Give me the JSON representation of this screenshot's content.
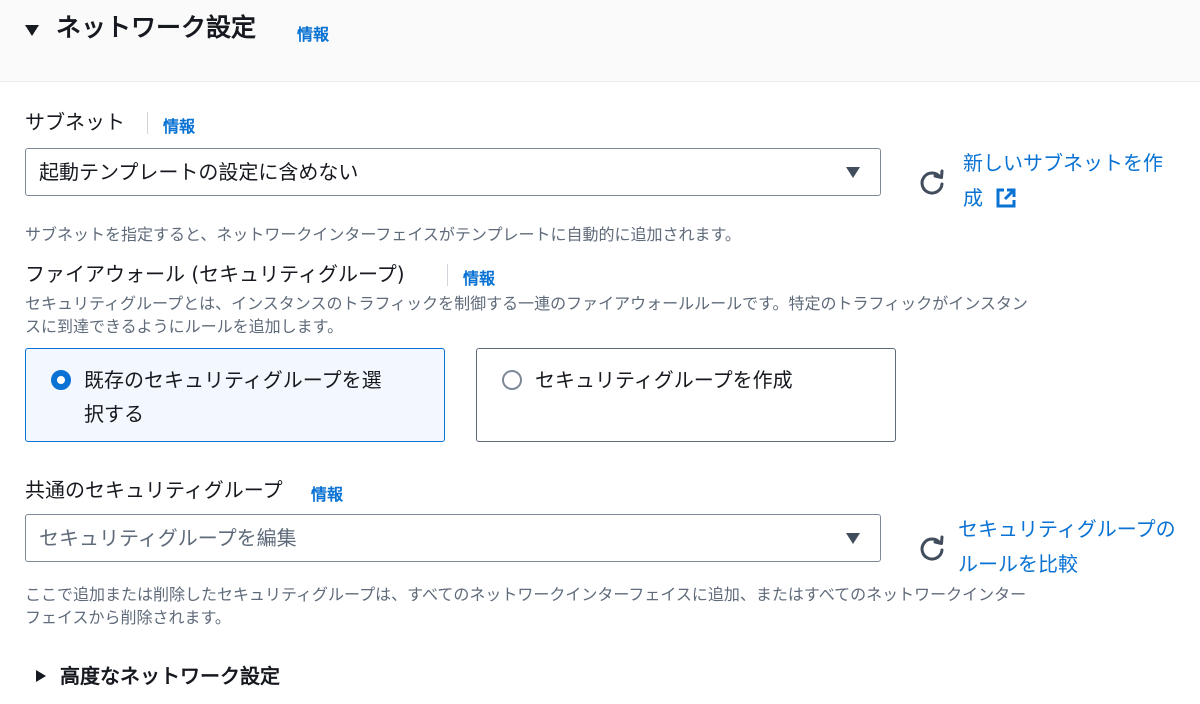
{
  "section": {
    "title": "ネットワーク設定",
    "info": "情報"
  },
  "subnet": {
    "label": "サブネット",
    "info": "情報",
    "selected": "起動テンプレートの設定に含めない",
    "create_link_line1": "新しいサブネットを作",
    "create_link_line2": "成",
    "description": "サブネットを指定すると、ネットワークインターフェイスがテンプレートに自動的に追加されます。"
  },
  "firewall": {
    "label": "ファイアウォール (セキュリティグループ)",
    "info": "情報",
    "description_line1": "セキュリティグループとは、インスタンスのトラフィックを制御する一連のファイアウォールルールです。特定のトラフィックがインスタン",
    "description_line2": "スに到達できるようにルールを追加します。",
    "options": [
      {
        "label_line1": "既存のセキュリティグループを選",
        "label_line2": "択する",
        "selected": true
      },
      {
        "label_line1": "セキュリティグループを作成",
        "label_line2": "",
        "selected": false
      }
    ]
  },
  "common_sg": {
    "label": "共通のセキュリティグループ",
    "info": "情報",
    "placeholder": "セキュリティグループを編集",
    "compare_link_line1": "セキュリティグループの",
    "compare_link_line2": "ルールを比較",
    "description_line1": "ここで追加または削除したセキュリティグループは、すべてのネットワークインターフェイスに追加、またはすべてのネットワークインター",
    "description_line2": "フェイスから削除されます。"
  },
  "advanced": {
    "title": "高度なネットワーク設定"
  },
  "colors": {
    "link": "#0972d3",
    "text": "#16191f",
    "muted": "#5f6b7a",
    "selected_tile_bg": "#f2f8fd"
  },
  "icons": [
    "caret-down-icon",
    "refresh-icon",
    "external-link-icon",
    "radio-selected-icon",
    "radio-unselected-icon",
    "caret-right-icon",
    "dropdown-arrow-icon"
  ]
}
